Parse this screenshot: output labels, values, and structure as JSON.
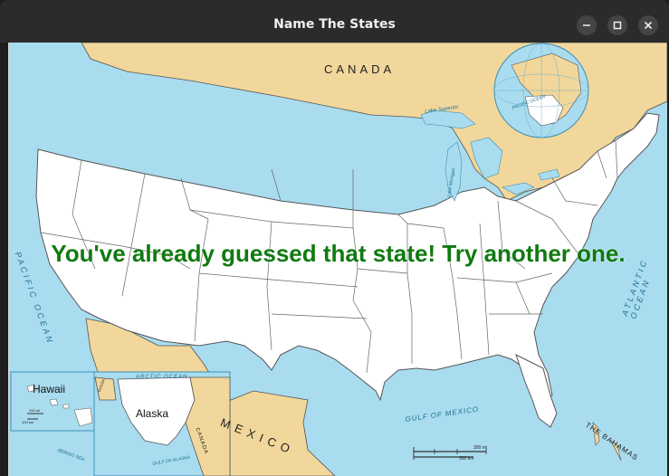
{
  "window": {
    "title": "Name The States",
    "controls": {
      "minimize": "–",
      "maximize": "□",
      "close": "×"
    }
  },
  "game": {
    "message": "You've already guessed that state! Try another one.",
    "message_color": "#107a10"
  },
  "map": {
    "labels": {
      "canada": "CANADA",
      "mexico": "MEXICO",
      "gulf": "GULF OF MEXICO",
      "atlantic": "ATLANTIC OCEAN",
      "pacific": "PACIFIC OCEAN",
      "bahamas": "THE BAHAMAS",
      "hawaii": "Hawaii",
      "alaska": "Alaska",
      "arctic": "ARCTIC OCEAN",
      "bering": "BERING SEA",
      "gulf_alaska": "GULF OF ALASKA",
      "lake_superior": "Lake Superior",
      "lake_michigan": "Lake Michigan",
      "inset_pacific": "PACIFIC OCEAN",
      "inset_canada": "CANADA",
      "inset_russia": "RUSSIA",
      "scale_mi": "300 mi",
      "scale_km": "300 km",
      "hawaii_scale_mi": "100 mi",
      "hawaii_scale_km": "100 km"
    },
    "colors": {
      "water": "#a9dcef",
      "land_foreign": "#f1d79b",
      "land_us": "#ffffff",
      "border": "#555555"
    }
  }
}
